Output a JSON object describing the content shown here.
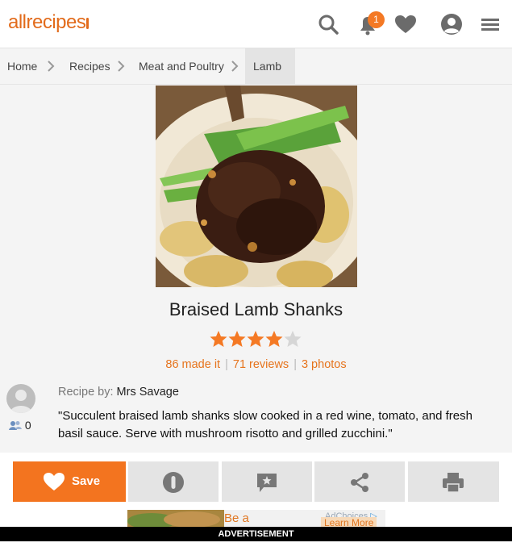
{
  "header": {
    "logo": "allrecipes",
    "notification_count": "1",
    "icons": [
      "search-icon",
      "notification-bell-icon",
      "favorites-heart-icon",
      "profile-icon",
      "menu-icon"
    ]
  },
  "breadcrumb": [
    "Home",
    "Recipes",
    "Meat and Poultry",
    "Lamb"
  ],
  "recipe": {
    "title": "Braised Lamb Shanks",
    "rating": 4,
    "rating_max": 5,
    "made_it": "86 made it",
    "reviews": "71 reviews",
    "photos": "3 photos",
    "byline_label": "Recipe by:",
    "author": "Mrs Savage",
    "followers": "0",
    "description": "\"Succulent braised lamb shanks slow cooked in a red wine, tomato, and fresh basil sauce. Serve with mushroom risotto and grilled zucchini.\""
  },
  "actions": {
    "save_label": "Save",
    "icons": [
      "heart-icon",
      "made-it-icon",
      "review-icon",
      "share-icon",
      "print-icon"
    ]
  },
  "ad": {
    "text": "Be a",
    "text2": "Learn More",
    "choices": "AdChoices",
    "label": "ADVERTISEMENT"
  },
  "colors": {
    "brand_orange": "#f3741f",
    "star": "#f47924",
    "star_empty": "#d6d6d6"
  }
}
